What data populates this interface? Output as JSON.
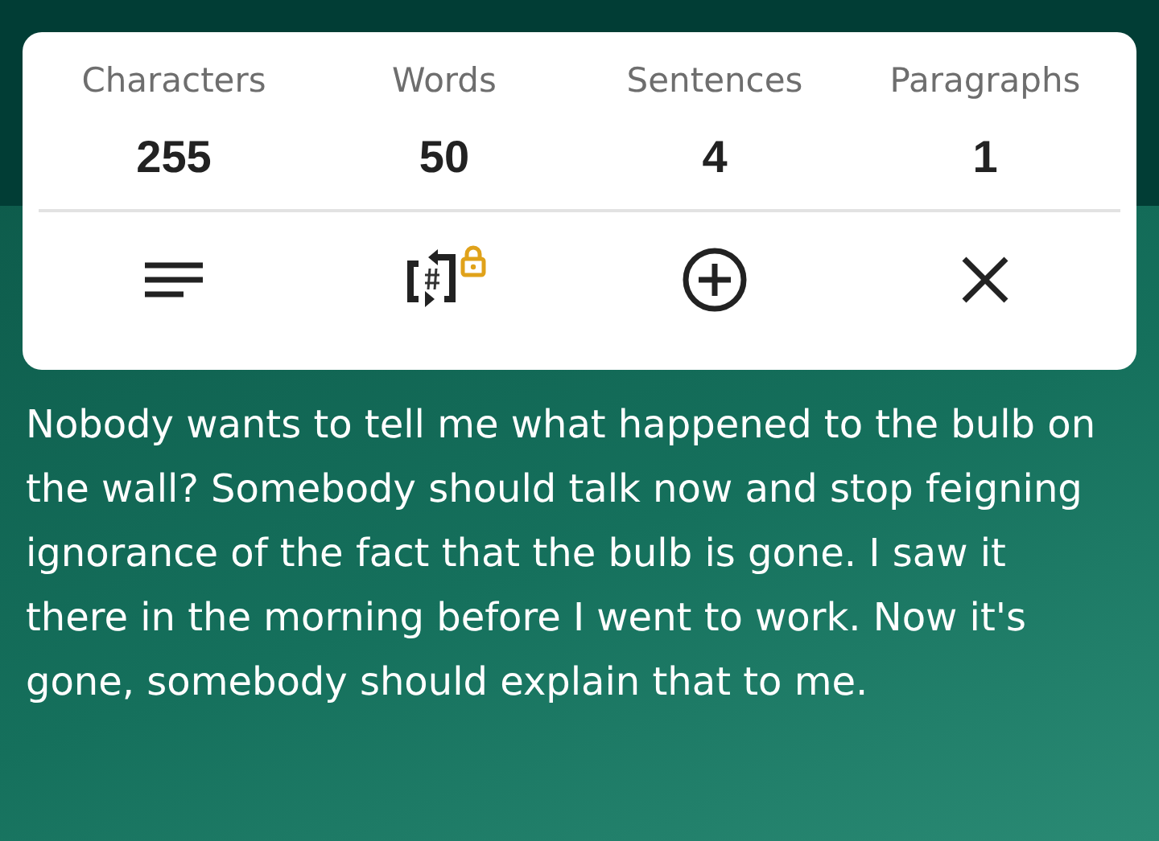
{
  "stats": [
    {
      "label": "Characters",
      "value": "255"
    },
    {
      "label": "Words",
      "value": "50"
    },
    {
      "label": "Sentences",
      "value": "4"
    },
    {
      "label": "Paragraphs",
      "value": "1"
    }
  ],
  "actions": [
    {
      "kind": "format"
    },
    {
      "kind": "convert"
    },
    {
      "kind": "add"
    },
    {
      "kind": "close"
    }
  ],
  "text": "Nobody wants to tell me what happened to the bulb on the wall? Somebody should talk now and stop feigning ignorance of the fact that the bulb is gone. I saw it there in the morning before I went to work. Now it's gone, somebody should explain that to me."
}
